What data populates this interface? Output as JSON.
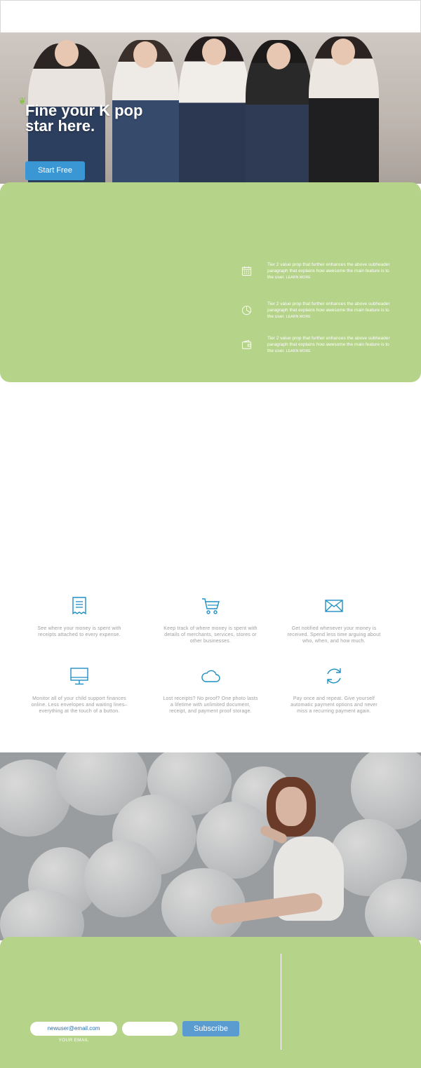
{
  "hero": {
    "title": "Fine your K pop star here.",
    "cta_label": "Start Free"
  },
  "features": [
    {
      "icon": "calendar-icon",
      "text": "Tier 2 value prop that further enhances the above subheader paragraph that explains how awesome the main feature is to the user.",
      "more": "LEARN MORE"
    },
    {
      "icon": "pie-chart-icon",
      "text": "Tier 2 value prop that further enhances the above subheader paragraph that explains how awesome the main feature is to the user.",
      "more": "LEARN MORE"
    },
    {
      "icon": "wallet-icon",
      "text": "Tier 2 value prop that further enhances the above subheader paragraph that explains how awesome the main feature is to the user.",
      "more": "LEARN MORE"
    }
  ],
  "services": [
    {
      "icon": "receipt-icon",
      "text": "See where your money is spent with receipts attached to every expense."
    },
    {
      "icon": "cart-icon",
      "text": "Keep track of where money is spent with details of merchants, services, stores or other businesses."
    },
    {
      "icon": "mail-icon",
      "text": "Get notified whenever your money is received. Spend less time arguing about who, when, and how much."
    },
    {
      "icon": "monitor-icon",
      "text": "Monitor all of your child support finances online. Less envelopes and waiting lines–everything at the touch of a button."
    },
    {
      "icon": "cloud-icon",
      "text": "Lost receipts? No proof? One photo lasts a lifetime with unlimited document, receipt, and payment proof storage."
    },
    {
      "icon": "refresh-icon",
      "text": "Pay once and repeat. Give yourself automatic payment options and never miss a recurring payment again."
    }
  ],
  "subscribe": {
    "email_value": "newuser@email.com",
    "email_label": "YOUR EMAIL",
    "button_label": "Subscribe"
  },
  "colors": {
    "green": "#b5d389",
    "accent_blue": "#3a97d4",
    "icon_blue": "#1f8fc4"
  }
}
